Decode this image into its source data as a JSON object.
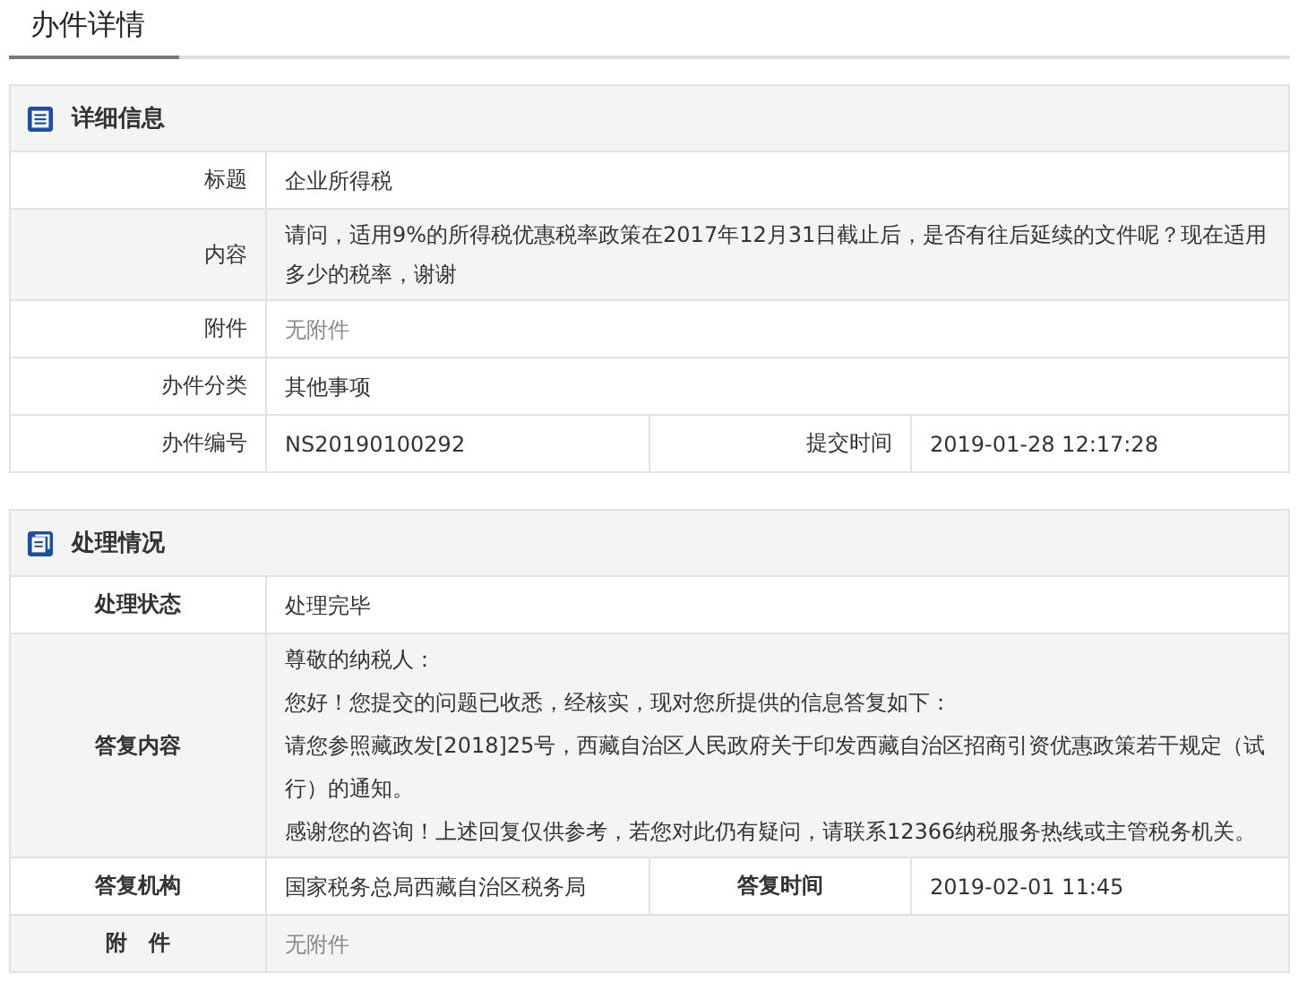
{
  "tab": {
    "label": "办件详情",
    "selected": true
  },
  "sections": [
    {
      "title": "详细信息",
      "rows": [
        {
          "cells": [
            {
              "label": "标题",
              "value": "企业所得税"
            }
          ]
        },
        {
          "cells": [
            {
              "label": "内容",
              "value": "请问，适用9%的所得税优惠税率政策在2017年12月31日截止后，是否有往后延续的文件呢？现在适用多少的税率，谢谢"
            }
          ]
        },
        {
          "cells": [
            {
              "label": "附件",
              "value": "无附件",
              "muted": true
            }
          ]
        },
        {
          "cells": [
            {
              "label": "办件分类",
              "value": "其他事项"
            }
          ]
        },
        {
          "cells": [
            {
              "label": "办件编号",
              "value": "NS20190100292"
            },
            {
              "label": "提交时间",
              "value": "2019-01-28 12:17:28"
            }
          ]
        }
      ]
    },
    {
      "title": "处理情况",
      "rows": [
        {
          "cells": [
            {
              "label": "处理状态",
              "value": "处理完毕"
            }
          ]
        },
        {
          "cells": [
            {
              "label": "答复内容",
              "paragraphs": [
                "尊敬的纳税人：",
                "您好！您提交的问题已收悉，经核实，现对您所提供的信息答复如下：",
                "请您参照藏政发[2018]25号，西藏自治区人民政府关于印发西藏自治区招商引资优惠政策若干规定（试行）的通知。",
                "感谢您的咨询！上述回复仅供参考，若您对此仍有疑问，请联系12366纳税服务热线或主管税务机关。"
              ]
            }
          ]
        },
        {
          "cells": [
            {
              "label": "答复机构",
              "value": "国家税务总局西藏自治区税务局"
            },
            {
              "label": "答复时间",
              "value": "2019-02-01 11:45"
            }
          ]
        },
        {
          "cells": [
            {
              "label": "附　件",
              "value": "无附件",
              "muted": true
            }
          ]
        }
      ]
    }
  ]
}
